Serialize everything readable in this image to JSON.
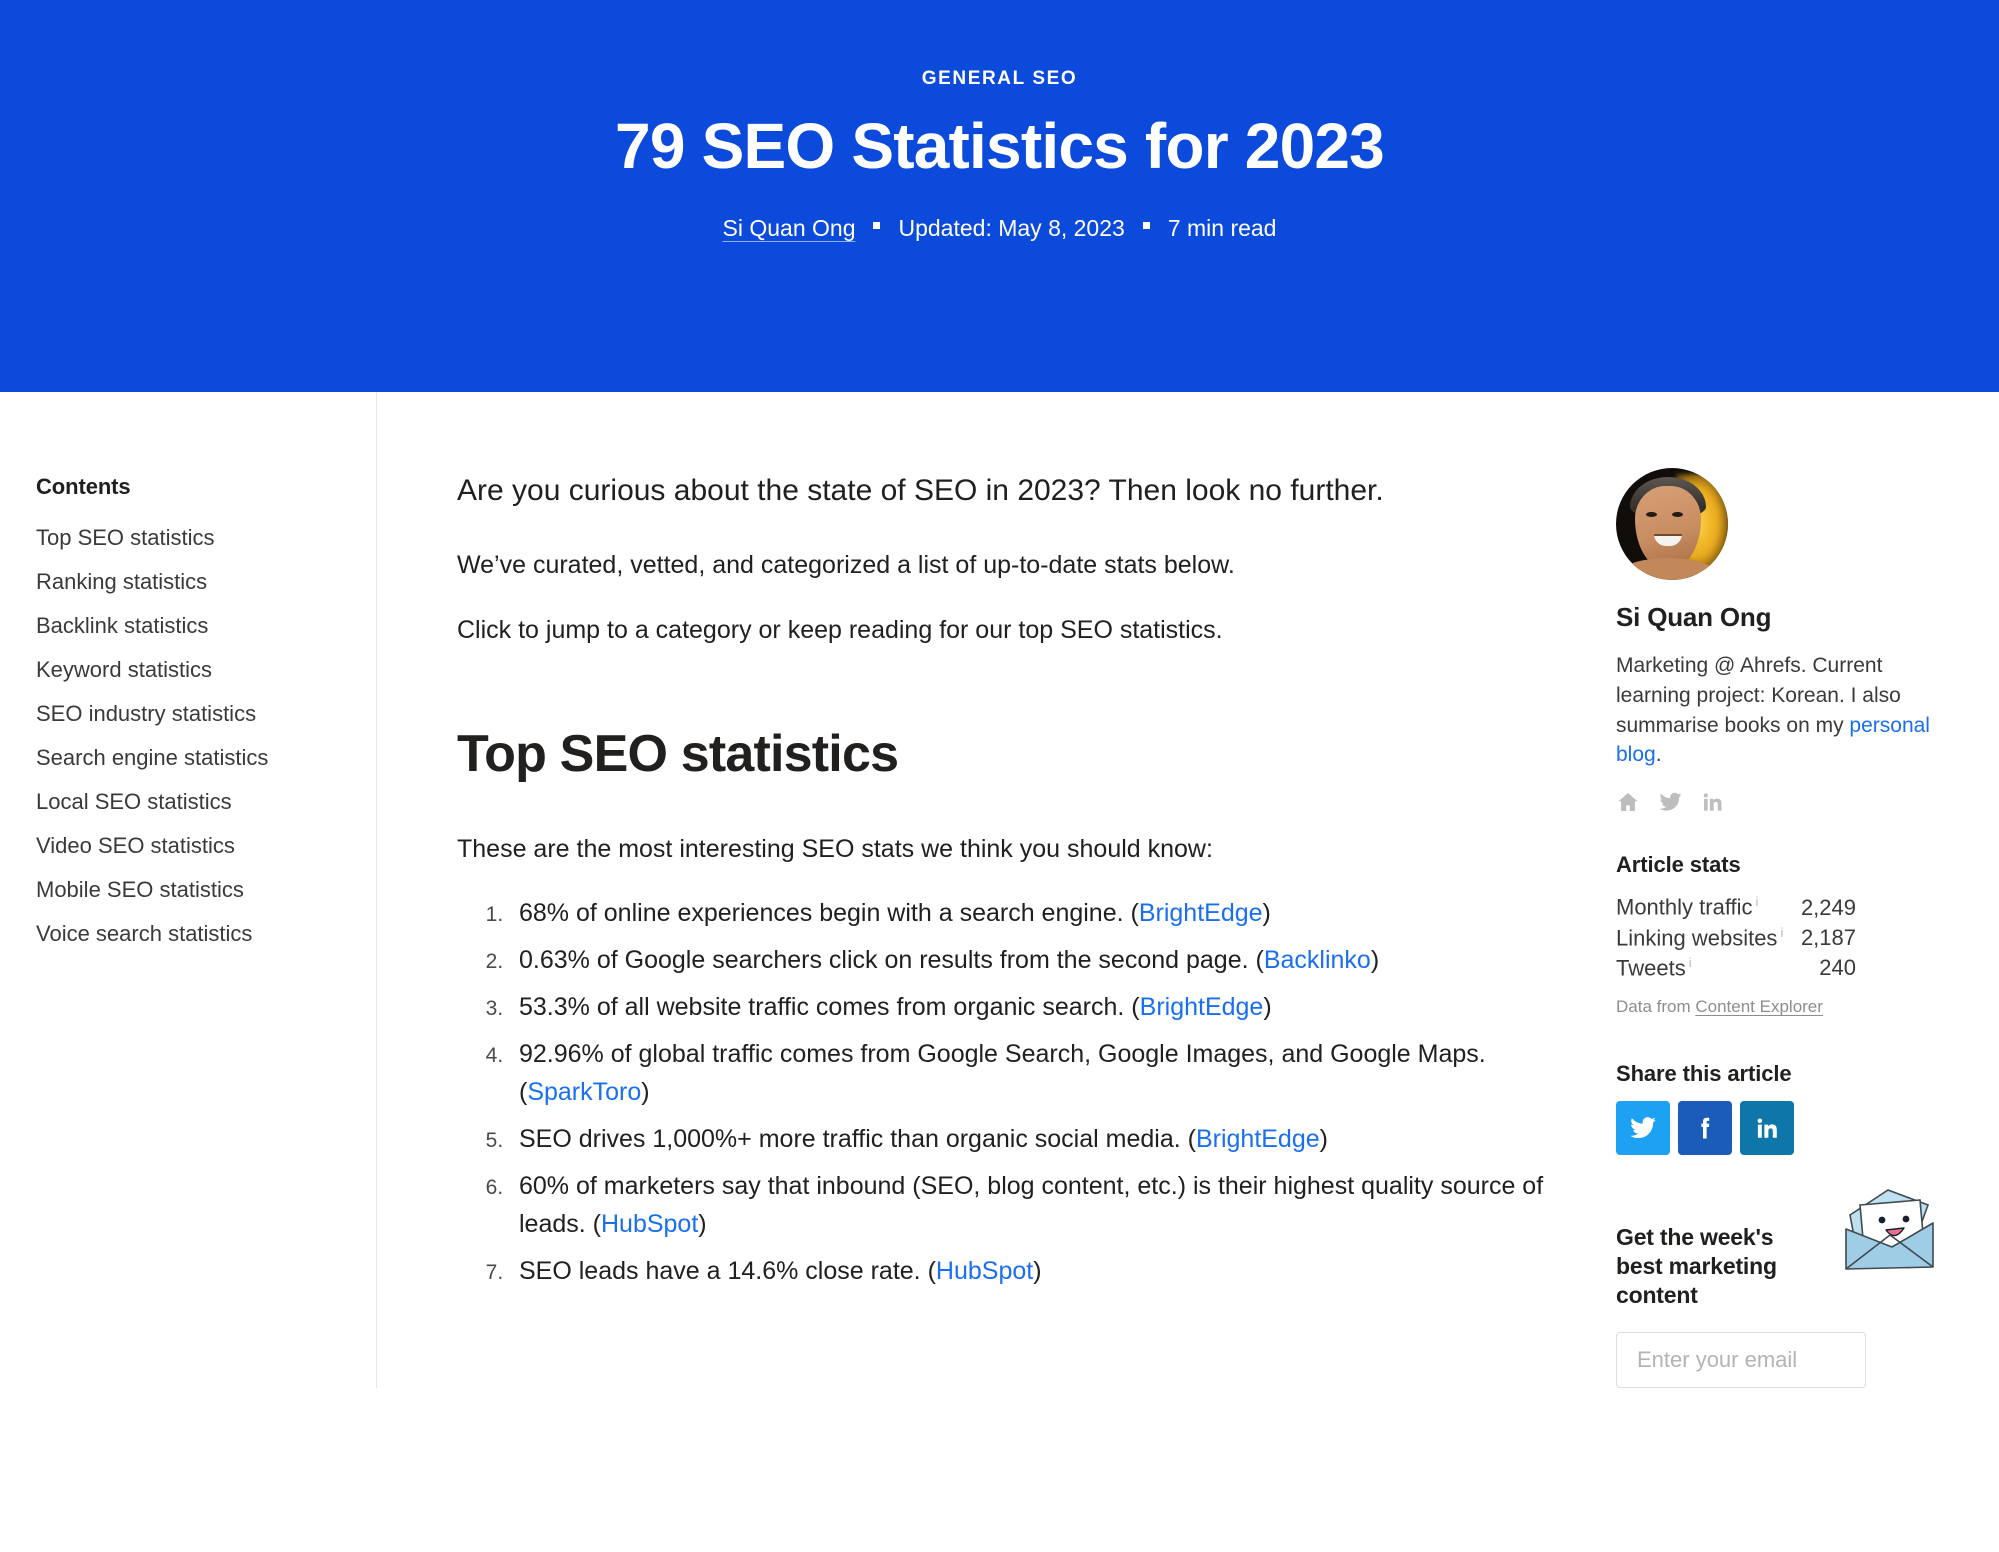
{
  "hero": {
    "eyebrow": "GENERAL SEO",
    "title": "79 SEO Statistics for 2023",
    "author": "Si Quan Ong",
    "updated": "Updated: May 8, 2023",
    "read_time": "7 min read",
    "background_color": "#0b4ada"
  },
  "toc": {
    "title": "Contents",
    "items": [
      {
        "label": "Top SEO statistics"
      },
      {
        "label": "Ranking statistics"
      },
      {
        "label": "Backlink statistics"
      },
      {
        "label": "Keyword statistics"
      },
      {
        "label": "SEO industry statistics"
      },
      {
        "label": "Search engine statistics"
      },
      {
        "label": "Local SEO statistics"
      },
      {
        "label": "Video SEO statistics"
      },
      {
        "label": "Mobile SEO statistics"
      },
      {
        "label": "Voice search statistics"
      }
    ]
  },
  "main": {
    "lede": "Are you curious about the state of SEO in 2023? Then look no further.",
    "paragraph_2": "We’ve curated, vetted, and categorized a list of up-to-date stats below.",
    "paragraph_3": "Click to jump to a category or keep reading for our top SEO statistics.",
    "section_heading": "Top SEO statistics",
    "section_intro": "These are the most interesting SEO stats we think you should know:",
    "link_color": "#1a6ff0",
    "stats": [
      {
        "number": "1.",
        "text": "68% of online experiences begin with a search engine. (",
        "source": "BrightEdge",
        "tail": ")"
      },
      {
        "number": "2.",
        "text": "0.63% of Google searchers click on results from the second page. (",
        "source": "Backlinko",
        "tail": ")"
      },
      {
        "number": "3.",
        "text": "53.3% of all website traffic comes from organic search. (",
        "source": "BrightEdge",
        "tail": ")"
      },
      {
        "number": "4.",
        "text": "92.96% of global traffic comes from Google Search, Google Images, and Google Maps. (",
        "source": "SparkToro",
        "tail": ")"
      },
      {
        "number": "5.",
        "text": "SEO drives 1,000%+ more traffic than organic social media. (",
        "source": "BrightEdge",
        "tail": ")"
      },
      {
        "number": "6.",
        "text": "60% of marketers say that inbound (SEO, blog content, etc.) is their highest quality source of leads. (",
        "source": "HubSpot",
        "tail": ")"
      },
      {
        "number": "7.",
        "text": "SEO leads have a 14.6% close rate. (",
        "source": "HubSpot",
        "tail": ")"
      }
    ]
  },
  "aside": {
    "author": {
      "name": "Si Quan Ong",
      "bio_before": "Marketing @ Ahrefs. Current learning project: Korean. I also summarise books on my ",
      "bio_link": "personal blog",
      "bio_after": ".",
      "social": [
        {
          "name": "home-icon",
          "label": "Personal website"
        },
        {
          "name": "twitter-icon",
          "label": "Twitter"
        },
        {
          "name": "linkedin-icon",
          "label": "LinkedIn"
        }
      ]
    },
    "article_stats": {
      "title": "Article stats",
      "rows": [
        {
          "label": "Monthly traffic",
          "info": "i",
          "value": "2,249"
        },
        {
          "label": "Linking websites",
          "info": "i",
          "value": "2,187"
        },
        {
          "label": "Tweets",
          "info": "i",
          "value": "240"
        }
      ],
      "data_from_prefix": "Data from ",
      "data_from_link": "Content Explorer"
    },
    "share": {
      "title": "Share this article",
      "buttons": [
        {
          "name": "twitter",
          "label": "Share on Twitter",
          "color": "#1DA1F2"
        },
        {
          "name": "facebook",
          "label": "Share on Facebook",
          "color": "#1B5CB8"
        },
        {
          "name": "linkedin",
          "label": "Share on LinkedIn",
          "color": "#0E76A8"
        }
      ]
    },
    "newsletter": {
      "title": "Get the week's best marketing content",
      "placeholder": "Enter your email",
      "value": ""
    }
  }
}
